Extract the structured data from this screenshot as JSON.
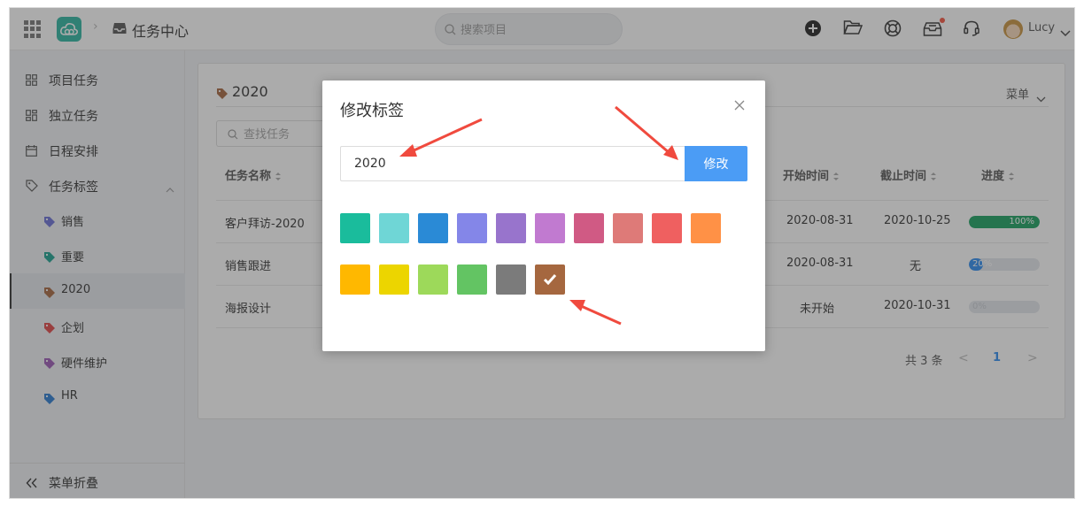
{
  "header": {
    "breadcrumb_title": "任务中心",
    "search_placeholder": "搜索项目",
    "user_name": "Lucy",
    "icons": [
      "apps-icon",
      "cloud-logo-icon",
      "inbox-icon",
      "plus-icon",
      "folder-icon",
      "help-ring-icon",
      "archive-icon",
      "headset-icon",
      "avatar-icon"
    ]
  },
  "sidebar": {
    "items": [
      {
        "label": "项目任务",
        "icon": "grid-icon"
      },
      {
        "label": "独立任务",
        "icon": "layout-icon"
      },
      {
        "label": "日程安排",
        "icon": "calendar-icon"
      },
      {
        "label": "任务标签",
        "icon": "tag-outline-icon"
      }
    ],
    "tags": [
      {
        "label": "销售",
        "color": "#6a6fd6"
      },
      {
        "label": "重要",
        "color": "#1aa090"
      },
      {
        "label": "2020",
        "color": "#a5673f",
        "active": true
      },
      {
        "label": "企划",
        "color": "#e04545"
      },
      {
        "label": "硬件维护",
        "color": "#9b59b6"
      },
      {
        "label": "HR",
        "color": "#2a7bd1"
      }
    ],
    "collapse_label": "菜单折叠"
  },
  "card": {
    "title": "2020",
    "title_tag_color": "#a5673f",
    "menu_label": "菜单",
    "search_placeholder": "查找任务",
    "columns": {
      "name": "任务名称",
      "start": "开始时间",
      "end": "截止时间",
      "progress": "进度"
    },
    "rows": [
      {
        "name": "客户拜访-2020",
        "start": "2020-08-31",
        "end": "2020-10-25",
        "progress_text": "100%",
        "progress": 1.0,
        "progress_color": "#19a15f"
      },
      {
        "name": "销售跟进",
        "start": "2020-08-31",
        "end": "无",
        "progress_text": "20%",
        "progress": 0.2,
        "progress_color": "#2d8cf0"
      },
      {
        "name": "海报设计",
        "start": "未开始",
        "end": "2020-10-31",
        "progress_text": "0%",
        "progress": 0.0,
        "progress_color": "#2d8cf0"
      }
    ],
    "pager": {
      "total": "共 3 条",
      "prev": "<",
      "page": "1",
      "next": ">"
    }
  },
  "modal": {
    "title": "修改标签",
    "input_value": "2020",
    "button_label": "修改",
    "selected_color": "#a5673f",
    "colors": [
      "#1abc9c",
      "#6fd6d6",
      "#2a8ad6",
      "#8486e8",
      "#9874cc",
      "#c17ad0",
      "#d05a84",
      "#de7a78",
      "#ef6060",
      "#ff9146",
      "#ffb800",
      "#ecd500",
      "#9dd95a",
      "#63c463",
      "#7b7b7b",
      "#a5673f"
    ]
  },
  "accent_color": "#4b9cf5",
  "annotation_color": "#f04a3e"
}
